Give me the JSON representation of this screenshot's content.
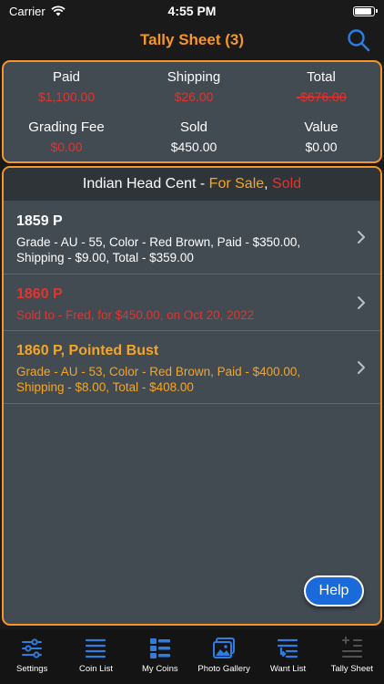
{
  "status": {
    "carrier": "Carrier",
    "time": "4:55 PM"
  },
  "nav": {
    "title": "Tally Sheet (3)"
  },
  "summary": {
    "paid_label": "Paid",
    "paid_value": "$1,100.00",
    "shipping_label": "Shipping",
    "shipping_value": "$26.00",
    "total_label": "Total",
    "total_value": "-$676.00",
    "grading_label": "Grading Fee",
    "grading_value": "$0.00",
    "sold_label": "Sold",
    "sold_value": "$450.00",
    "value_label": "Value",
    "value_value": "$0.00"
  },
  "list": {
    "header_prefix": "Indian Head Cent - ",
    "header_forsale": "For Sale",
    "header_sep": ", ",
    "header_sold": "Sold",
    "rows": [
      {
        "title": "1859 P",
        "detail": "Grade - AU - 55, Color - Red Brown, Paid - $350.00, Shipping - $9.00, Total - $359.00"
      },
      {
        "title": "1860 P",
        "detail": "Sold to - Fred, for $450.00, on Oct 20, 2022"
      },
      {
        "title": "1860 P, Pointed Bust",
        "detail": "Grade - AU - 53, Color - Red Brown, Paid - $400.00, Shipping - $8.00, Total - $408.00"
      }
    ]
  },
  "help_label": "Help",
  "tabs": [
    {
      "label": "Settings",
      "icon": "sliders-icon"
    },
    {
      "label": "Coin List",
      "icon": "list-icon"
    },
    {
      "label": "My Coins",
      "icon": "grid-list-icon"
    },
    {
      "label": "Photo Gallery",
      "icon": "photos-icon"
    },
    {
      "label": "Want List",
      "icon": "want-list-icon"
    },
    {
      "label": "Tally Sheet",
      "icon": "tally-icon"
    }
  ],
  "colors": {
    "accent": "#f5962a",
    "red": "#e8322c",
    "orange": "#f5a623",
    "panel": "#424a52",
    "tab_blue": "#2e7de0"
  }
}
